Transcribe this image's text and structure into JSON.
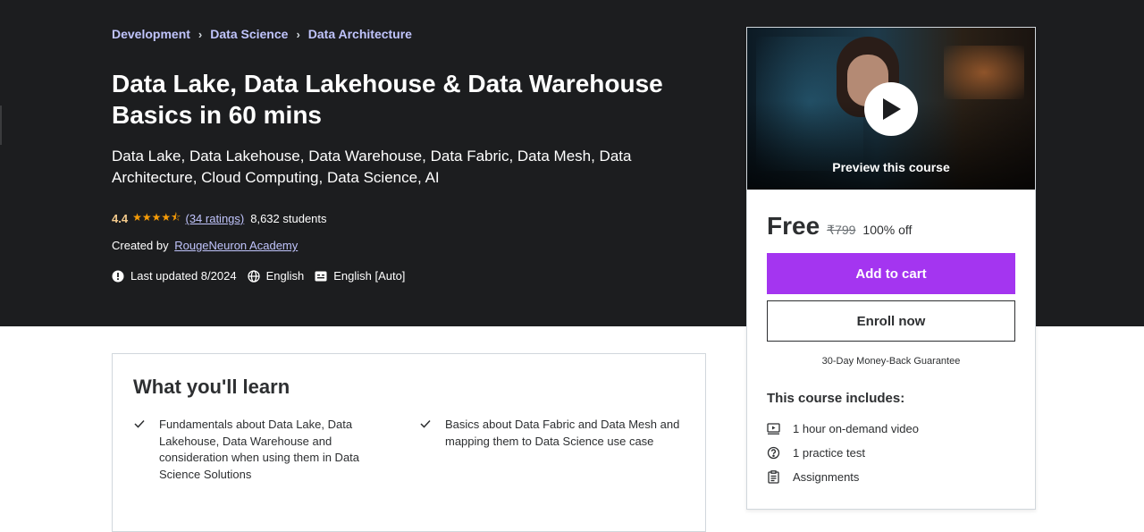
{
  "breadcrumb": [
    {
      "label": "Development"
    },
    {
      "label": "Data Science"
    },
    {
      "label": "Data Architecture"
    }
  ],
  "course": {
    "title": "Data Lake, Data Lakehouse & Data Warehouse Basics in 60 mins",
    "subtitle": "Data Lake, Data Lakehouse, Data Warehouse, Data Fabric, Data Mesh, Data Architecture, Cloud Computing, Data Science, AI",
    "rating": "4.4",
    "rating_value": 4.4,
    "stars": "★★★★⯪",
    "ratings_count": "(34 ratings)",
    "students": "8,632 students",
    "created_by_label": "Created by",
    "author": "RougeNeuron Academy",
    "last_updated": "Last updated 8/2024",
    "language": "English",
    "captions": "English [Auto]"
  },
  "card": {
    "preview_label": "Preview this course",
    "price_now": "Free",
    "price_old": "₹799",
    "discount": "100% off",
    "add_to_cart": "Add to cart",
    "enroll_now": "Enroll now",
    "guarantee": "30-Day Money-Back Guarantee",
    "includes_title": "This course includes:",
    "includes": [
      {
        "icon": "video-icon",
        "label": "1 hour on-demand video"
      },
      {
        "icon": "question-icon",
        "label": "1 practice test"
      },
      {
        "icon": "assignment-icon",
        "label": "Assignments"
      }
    ]
  },
  "learn": {
    "title": "What you'll learn",
    "items": [
      "Fundamentals about Data Lake, Data Lakehouse, Data Warehouse and consideration when using them in Data Science Solutions",
      "Basics about Data Fabric and Data Mesh and mapping them to Data Science use case"
    ]
  },
  "colors": {
    "hero_bg": "#1c1d1f",
    "accent_purple": "#a435f0",
    "link_lavender": "#c0c4fc",
    "star_orange": "#f69c08"
  }
}
